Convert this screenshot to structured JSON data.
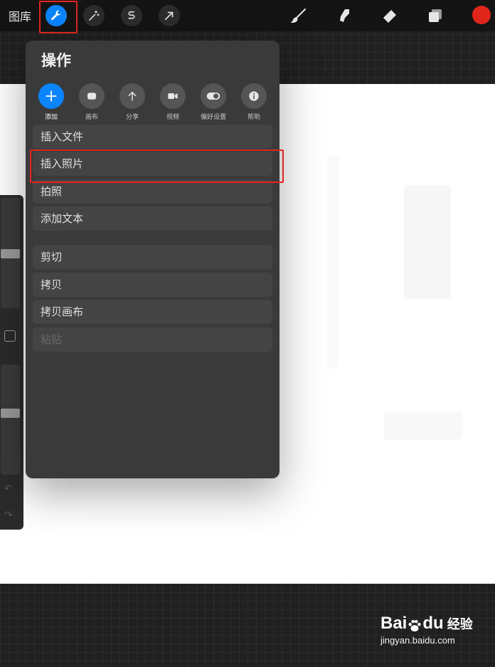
{
  "toolbar": {
    "gallery_label": "图库",
    "tools": [
      {
        "icon": "wrench-icon",
        "active": true
      },
      {
        "icon": "magic-wand-icon",
        "active": false
      },
      {
        "icon": "selection-s-icon",
        "active": false
      },
      {
        "icon": "transform-arrow-icon",
        "active": false
      }
    ],
    "right_tools": [
      "brush-icon",
      "smudge-icon",
      "eraser-icon",
      "layers-icon"
    ],
    "current_color": "#e0261b"
  },
  "actions_panel": {
    "title": "操作",
    "tabs": [
      {
        "label": "添加",
        "icon": "plus-icon",
        "active": true
      },
      {
        "label": "画布",
        "icon": "canvas-icon",
        "active": false
      },
      {
        "label": "分享",
        "icon": "share-arrow-icon",
        "active": false
      },
      {
        "label": "视频",
        "icon": "video-camera-icon",
        "active": false
      },
      {
        "label": "偏好设置",
        "icon": "toggle-icon",
        "active": false
      },
      {
        "label": "帮助",
        "icon": "info-icon",
        "active": false
      }
    ],
    "items_group1": [
      "插入文件",
      "插入照片",
      "拍照",
      "添加文本"
    ],
    "items_group2": [
      "剪切",
      "拷贝",
      "拷贝画布",
      "粘贴"
    ],
    "disabled_items": [
      "粘贴"
    ]
  },
  "highlight_color": "#e3271f",
  "watermark": {
    "brand": "Bai",
    "brand_suffix": "du",
    "text": "经验",
    "url": "jingyan.baidu.com"
  }
}
